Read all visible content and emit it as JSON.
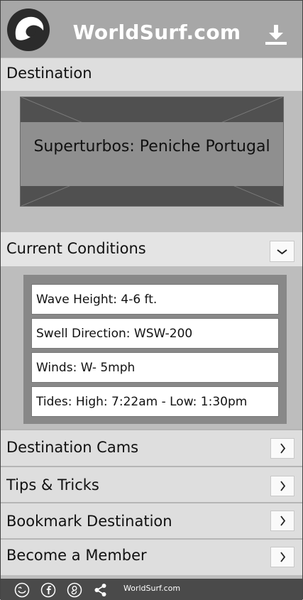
{
  "header": {
    "title": "WorldSurf.com"
  },
  "destination": {
    "section_label": "Destination",
    "name": "Superturbos: Peniche Portugal"
  },
  "conditions": {
    "section_label": "Current Conditions",
    "rows": [
      "Wave Height: 4-6 ft.",
      "Swell Direction: WSW-200",
      "Winds: W- 5mph",
      "Tides: High: 7:22am - Low: 1:30pm"
    ]
  },
  "nav": [
    {
      "label": "Destination Cams"
    },
    {
      "label": "Tips & Tricks"
    },
    {
      "label": "Bookmark Destination"
    },
    {
      "label": "Become a Member"
    }
  ],
  "footer": {
    "site": "WorldSurf.com",
    "icons": [
      "smiley-bird-icon",
      "facebook-icon",
      "google-plus-icon",
      "share-icon"
    ]
  },
  "colors": {
    "header_bg": "#a7a7a7",
    "title": "#ffffff",
    "footer_bg": "#4a4a4a"
  }
}
